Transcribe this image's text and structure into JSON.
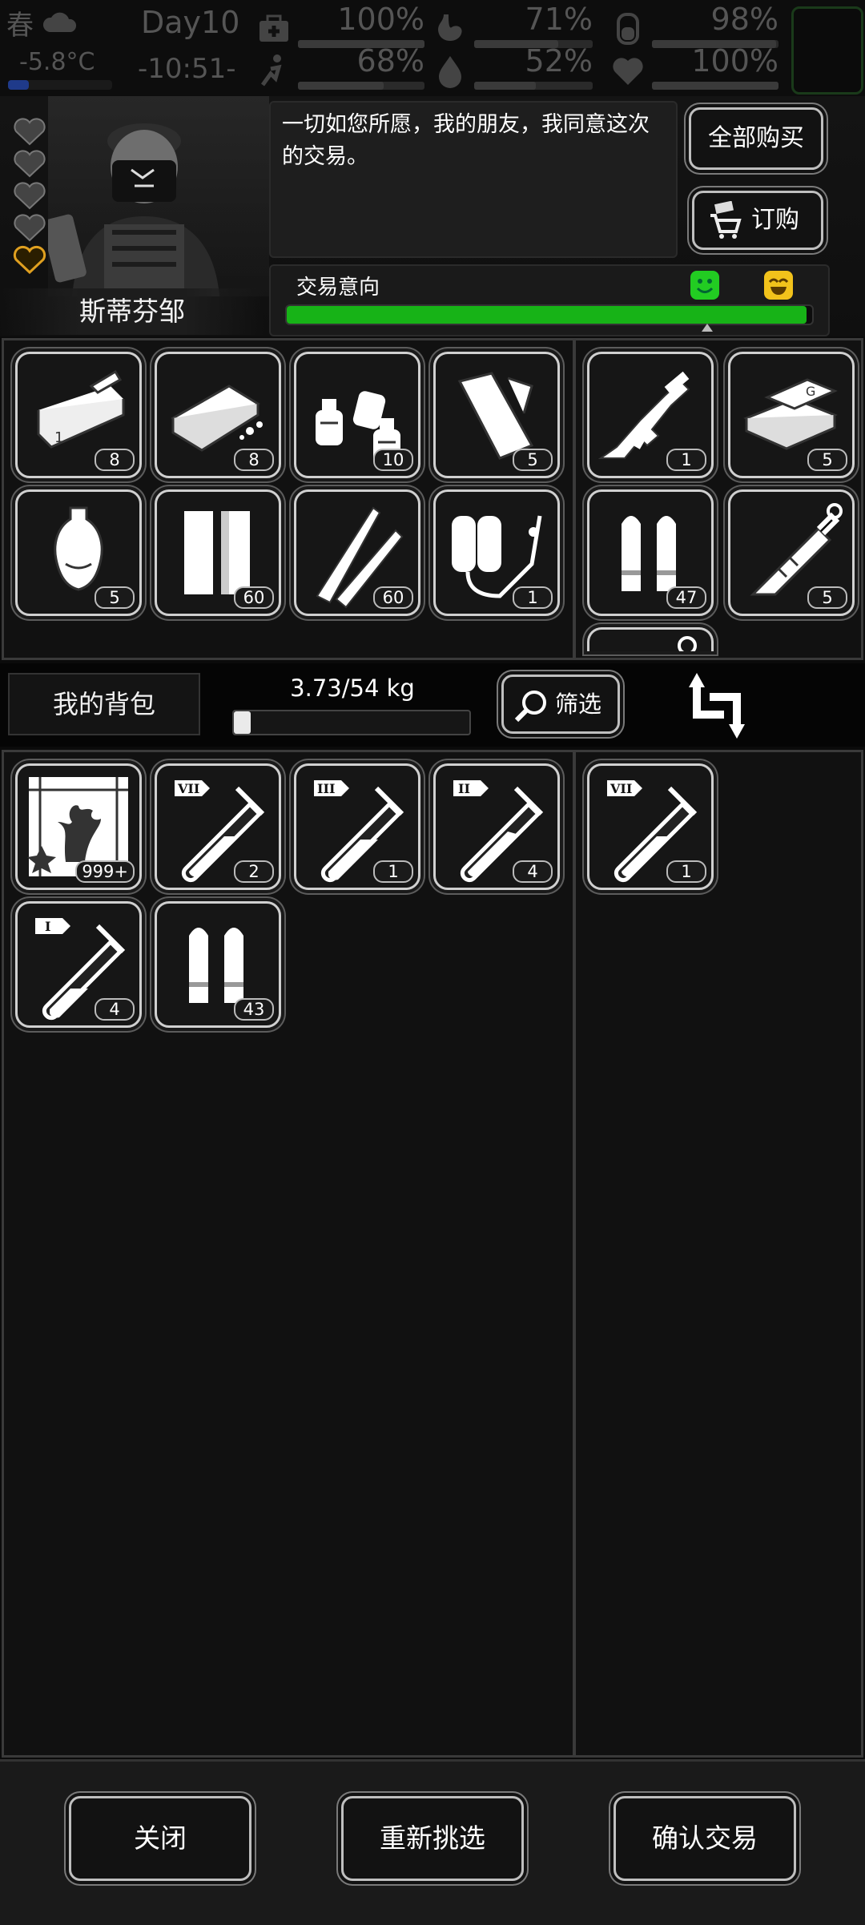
{
  "status": {
    "season": "春",
    "temperature": "-5.8°C",
    "day": "Day10",
    "time": "-10:51-",
    "stats": [
      {
        "icon": "medkit-icon",
        "value": "100%",
        "level": 1.0
      },
      {
        "icon": "stomach-icon",
        "value": "71%",
        "level": 0.71
      },
      {
        "icon": "bladder-icon",
        "value": "98%",
        "level": 0.98
      },
      {
        "icon": "running-icon",
        "value": "68%",
        "level": 0.68
      },
      {
        "icon": "water-drop-icon",
        "value": "52%",
        "level": 0.52
      },
      {
        "icon": "heart-icon",
        "value": "100%",
        "level": 1.0
      }
    ]
  },
  "trader": {
    "name": "斯蒂芬邹",
    "dialog": "一切如您所愿，我的朋友，我同意这次的交易。",
    "hearts_total": 5,
    "hearts_active": 1,
    "buy_all_label": "全部购买",
    "order_label": "订购",
    "intent_label": "交易意向",
    "intent_level": 0.92
  },
  "trader_items": [
    {
      "icon": "canned-food-icon",
      "count": "8"
    },
    {
      "icon": "bread-loaf-icon",
      "count": "8"
    },
    {
      "icon": "spray-bottles-icon",
      "count": "10"
    },
    {
      "icon": "cloth-roll-icon",
      "count": "5"
    },
    {
      "icon": "vase-icon",
      "count": "5"
    },
    {
      "icon": "battery-pack-icon",
      "count": "60"
    },
    {
      "icon": "rifle-rounds-icon",
      "count": "60"
    },
    {
      "icon": "gas-canisters-icon",
      "count": "1"
    }
  ],
  "trader_offer": [
    {
      "icon": "assault-rifle-icon",
      "count": "1"
    },
    {
      "icon": "gold-bars-icon",
      "count": "5"
    },
    {
      "icon": "pistol-rounds-icon",
      "count": "47"
    },
    {
      "icon": "syringe-icon",
      "count": "5"
    }
  ],
  "bag": {
    "title": "我的背包",
    "weight": "3.73/54 kg",
    "weight_level": 0.069,
    "filter_label": "筛选",
    "items": [
      {
        "icon": "coral-map-icon",
        "count": "999+"
      },
      {
        "icon": "test-tube-icon",
        "tier": "VII",
        "count": "2"
      },
      {
        "icon": "test-tube-icon",
        "tier": "III",
        "count": "1"
      },
      {
        "icon": "test-tube-icon",
        "tier": "II",
        "count": "4"
      },
      {
        "icon": "test-tube-icon",
        "tier": "I",
        "count": "4"
      },
      {
        "icon": "pistol-rounds-icon",
        "count": "43"
      }
    ],
    "offer": [
      {
        "icon": "test-tube-icon",
        "tier": "VII",
        "count": "1"
      }
    ]
  },
  "actions": {
    "close": "关闭",
    "reselect": "重新挑选",
    "confirm": "确认交易"
  },
  "colors": {
    "intent_fill": "#17b317",
    "heart_active": "#e0a020",
    "smile_green": "#22cc22",
    "smile_yellow": "#f2c21b"
  }
}
